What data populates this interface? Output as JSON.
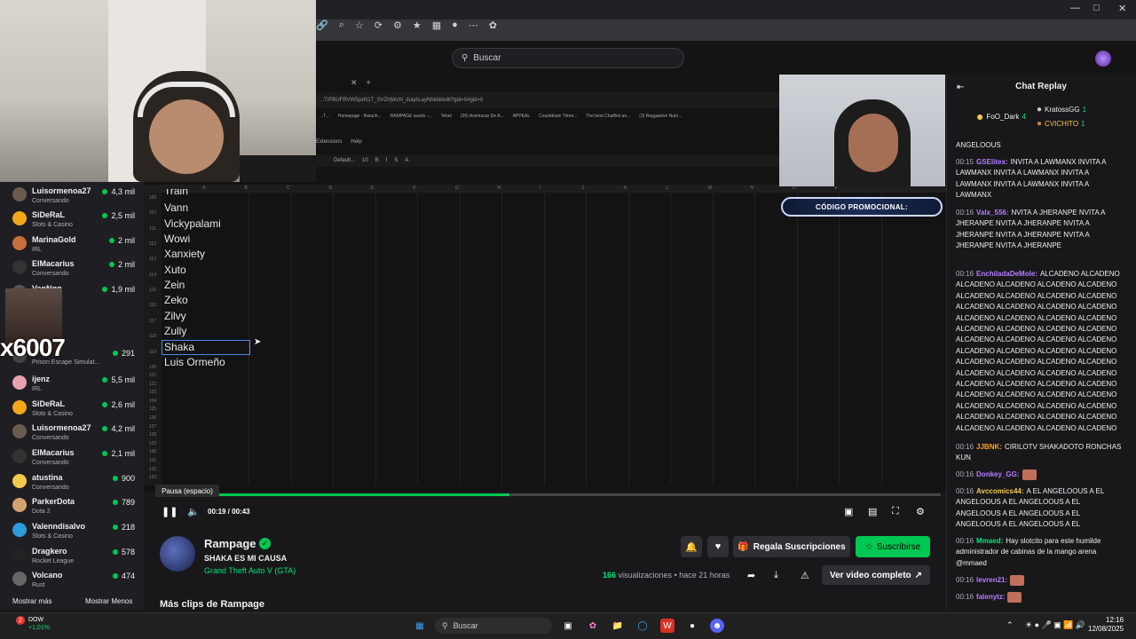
{
  "header": {
    "search_placeholder": "Buscar"
  },
  "sheet": {
    "url": "...T/PBUFRVW5pxN1T_SVZhjWcN_duqALayNhkId/edit?gid=0#gid=0",
    "bookmarks": [
      "...T...",
      "Homepage - Baruch...",
      "RAMPAGE avarts -...",
      "Tebet",
      "(36) Aventuras De A...",
      "APPEAL",
      "Countdown Timer...",
      "The best ChatBot an...",
      "(3) Reggaeton Num..."
    ],
    "menu": [
      "Extensions",
      "Help"
    ],
    "toolbar_font": "Default...",
    "toolbar_size": "10",
    "columns": [
      "A",
      "B",
      "C",
      "D",
      "E",
      "F",
      "G",
      "H",
      "I",
      "J",
      "K",
      "L",
      "M",
      "N",
      "O",
      "P"
    ],
    "rows": [
      {
        "num": "109",
        "name": "Train"
      },
      {
        "num": "110",
        "name": "Vann"
      },
      {
        "num": "111",
        "name": "Vickypalami"
      },
      {
        "num": "112",
        "name": "Wowi"
      },
      {
        "num": "113",
        "name": "Xanxiety"
      },
      {
        "num": "114",
        "name": "Xuto"
      },
      {
        "num": "115",
        "name": "Zein"
      },
      {
        "num": "116",
        "name": "Zeko"
      },
      {
        "num": "117",
        "name": "Zilvy"
      },
      {
        "num": "118",
        "name": "Zully"
      },
      {
        "num": "119",
        "name": "Shaka"
      },
      {
        "num": "120",
        "name": "Luis Ormeño"
      }
    ],
    "empty_rows": [
      "121",
      "122",
      "123",
      "124",
      "125",
      "126",
      "127",
      "128",
      "129",
      "130",
      "131",
      "132",
      "133"
    ]
  },
  "promo": "CÓDIGO PROMOCIONAL:",
  "player": {
    "tooltip": "Pausa (espacio)",
    "time": "00:19 / 00:43",
    "progress": 0.45
  },
  "sidebar": {
    "channels": [
      {
        "name": "Luisormenoa27",
        "cat": "Conversando",
        "viewers": "4,3 mil",
        "color": "#6b5b4e"
      },
      {
        "name": "SiDeRaL",
        "cat": "Slots & Casino",
        "viewers": "2,5 mil",
        "color": "#f2a71b"
      },
      {
        "name": "MarinaGold",
        "cat": "IRL",
        "viewers": "2 mil",
        "color": "#c9703f"
      },
      {
        "name": "ElMacarius",
        "cat": "Conversando",
        "viewers": "2 mil",
        "color": "#333333"
      },
      {
        "name": "VanNgg",
        "cat": "",
        "viewers": "1,9 mil",
        "color": "#555555"
      },
      {
        "name": "",
        "cat": "Prison Escape Simulat...",
        "viewers": "291",
        "color": "#444444"
      },
      {
        "name": "ijenz",
        "cat": "IRL",
        "viewers": "5,5 mil",
        "color": "#e9a0b0"
      },
      {
        "name": "SiDeRaL",
        "cat": "Slots & Casino",
        "viewers": "2,6 mil",
        "color": "#f2a71b"
      },
      {
        "name": "Luisormenoa27",
        "cat": "Conversando",
        "viewers": "4,2 mil",
        "color": "#6b5b4e"
      },
      {
        "name": "ElMacarius",
        "cat": "Conversando",
        "viewers": "2,1 mil",
        "color": "#333333"
      },
      {
        "name": "atustina",
        "cat": "Conversando",
        "viewers": "900",
        "color": "#f2c94c"
      },
      {
        "name": "ParkerDota",
        "cat": "Dota 2",
        "viewers": "789",
        "color": "#d4a373"
      },
      {
        "name": "Valenndisalvo",
        "cat": "Slots & Casino",
        "viewers": "218",
        "color": "#2d9cdb"
      },
      {
        "name": "Dragkero",
        "cat": "Rocket League",
        "viewers": "578",
        "color": "#222222"
      },
      {
        "name": "Volcano",
        "cat": "Rust",
        "viewers": "474",
        "color": "#666666"
      }
    ],
    "show_more": "Mostrar más",
    "show_less": "Mostrar Menos",
    "cam_text": "x6007"
  },
  "clip": {
    "channel": "Rampage",
    "title": "SHAKA ES MI CAUSA",
    "game": "Grand Theft Auto V (GTA)",
    "gift_label": "Regala Suscripciones",
    "sub_label": "Suscribirse",
    "views_count": "166",
    "views_label": " visualizaciones • hace 21 horas",
    "full_label": "Ver video completo",
    "more_clips": "Más clips de Rampage"
  },
  "chat": {
    "title": "Chat Replay",
    "leaders": [
      {
        "name": "FoO_Dark",
        "count": "4"
      },
      {
        "name": "KratossGG",
        "count": "1"
      },
      {
        "name": "CVICHITO",
        "count": "1"
      }
    ],
    "messages": [
      {
        "ts": "",
        "user": "",
        "color": "#efeff1",
        "text": "ANGELOOUS"
      },
      {
        "ts": "00:15",
        "user": "GSElitex",
        "color": "#b57cff",
        "text": "INVITA A LAWMANX INVITA A LAWMANX INVITA A LAWMANX INVITA A LAWMANX INVITA A LAWMANX INVITA A LAWMANX"
      },
      {
        "ts": "00:16",
        "user": "Valx_556",
        "color": "#b57cff",
        "text": "NVITA A JHERANPE NVITA A JHERANPE NVITA A JHERANPE NVITA A JHERANPE NVITA A JHERANPE NVITA A JHERANPE NVITA A JHERANPE"
      },
      {
        "ts": "00:16",
        "user": "EnchiladaDeMole",
        "color": "#b57cff",
        "text": "ALCADENO ALCADENO ALCADENO ALCADENO ALCADENO ALCADENO ALCADENO ALCADENO ALCADENO ALCADENO ALCADENO ALCADENO ALCADENO ALCADENO ALCADENO ALCADENO ALCADENO ALCADENO ALCADENO ALCADENO ALCADENO ALCADENO ALCADENO ALCADENO ALCADENO ALCADENO ALCADENO ALCADENO ALCADENO ALCADENO ALCADENO ALCADENO ALCADENO ALCADENO ALCADENO ALCADENO ALCADENO ALCADENO ALCADENO ALCADENO ALCADENO ALCADENO ALCADENO ALCADENO ALCADENO ALCADENO ALCADENO ALCADENO ALCADENO ALCADENO ALCADENO ALCADENO ALCADENO ALCADENO ALCADENO ALCADENO ALCADENO ALCADENO ALCADENO ALCADENO ALCADENO ALCADENO ALCADENO ALCADENO ALCADENO ALCADENO ALCADENO ALCADENO ALCADENO ALCADENO ALCADENO ALCADENO ALCADENO ALCADENO ALCADENO ALCADENO ALCADENO"
      },
      {
        "ts": "00:16",
        "user": "JJBNK",
        "color": "#ff9f1c",
        "text": "CIRILOTV SHAKADOTO RONCHAS KUN"
      },
      {
        "ts": "00:16",
        "user": "Donkey_GG",
        "color": "#b57cff",
        "text": ""
      },
      {
        "ts": "00:16",
        "user": "Avccomics44",
        "color": "#f2c94c",
        "text": "A EL ANGELOOUS A EL ANGELOOUS A EL ANGELOOUS A EL ANGELOOUS A EL ANGELOOUS A EL ANGELOOUS A EL ANGELOOUS A EL ANGELOOUS"
      },
      {
        "ts": "00:16",
        "user": "Mmaed",
        "color": "#00e676",
        "text": "Hay slotcito para este humilde administrador de cabinas de la mango arena @mmaed"
      },
      {
        "ts": "00:16",
        "user": "levren21",
        "color": "#b57cff",
        "text": ""
      },
      {
        "ts": "00:16",
        "user": "falenytz",
        "color": "#b57cff",
        "text": ""
      }
    ]
  },
  "taskbar": {
    "search_label": "Buscar",
    "stock_name": "DOW",
    "stock_change": "+1,01%",
    "time": "12:16",
    "date": "12/08/2025",
    "notif": "2"
  }
}
